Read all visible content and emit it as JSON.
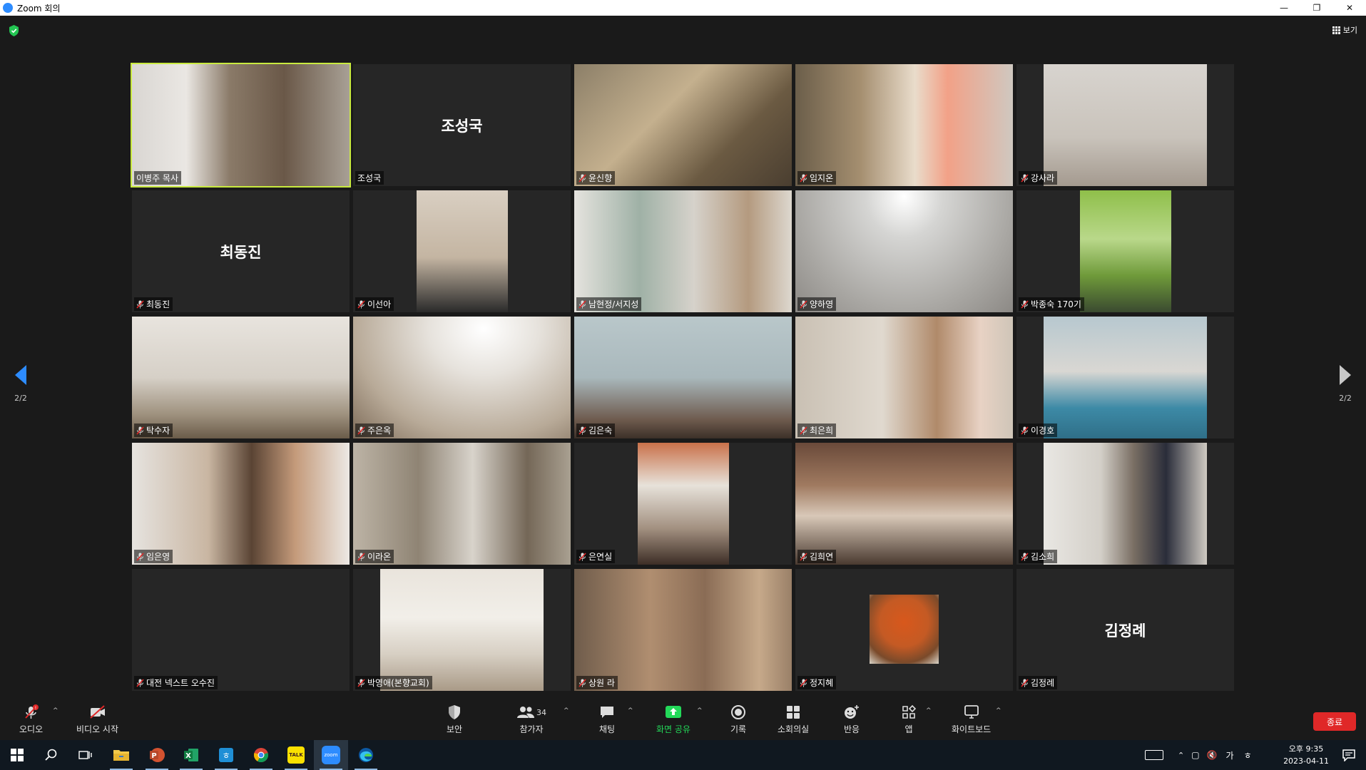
{
  "window": {
    "title": "Zoom 회의"
  },
  "top": {
    "view_label": "보기"
  },
  "nav": {
    "prev_page": "2/2",
    "next_page": "2/2"
  },
  "participants": [
    {
      "name": "이병주 목사",
      "video": true
    },
    {
      "name": "조성국",
      "video": false
    },
    {
      "name": "윤신향",
      "video": true
    },
    {
      "name": "임지온",
      "video": true
    },
    {
      "name": "강사라",
      "video": true
    },
    {
      "name": "최동진",
      "video": false
    },
    {
      "name": "이선아",
      "video": true
    },
    {
      "name": "남현정/서지성",
      "video": true
    },
    {
      "name": "양하영",
      "video": true
    },
    {
      "name": "박종숙 170기",
      "video": true
    },
    {
      "name": "탁수자",
      "video": true
    },
    {
      "name": "주은옥",
      "video": true
    },
    {
      "name": "김은숙",
      "video": true
    },
    {
      "name": "최은희",
      "video": true
    },
    {
      "name": "이경호",
      "video": true
    },
    {
      "name": "임은영",
      "video": true
    },
    {
      "name": "이라온",
      "video": true
    },
    {
      "name": "은연실",
      "video": true
    },
    {
      "name": "김희연",
      "video": true
    },
    {
      "name": "김소희",
      "video": true
    },
    {
      "name": "대전 넥스트 오수진",
      "video": false
    },
    {
      "name": "박영애(본향교회)",
      "video": true
    },
    {
      "name": "상원 라",
      "video": true
    },
    {
      "name": "정지혜",
      "video": false
    },
    {
      "name": "김정례",
      "video": false
    }
  ],
  "big_names": {
    "t1": "조성국",
    "t5": "최동진",
    "t24": "김정례"
  },
  "toolbar": {
    "audio": "오디오",
    "video": "비디오 시작",
    "security": "보안",
    "participants": "참가자",
    "participants_count": "34",
    "chat": "채팅",
    "share": "화면 공유",
    "record": "기록",
    "breakout": "소회의실",
    "reactions": "반응",
    "apps": "앱",
    "whiteboard": "화이트보드",
    "end": "종료"
  },
  "taskbar": {
    "ime_1": "가",
    "ime_2": "ㅎ",
    "time": "오후 9:35",
    "date": "2023-04-11",
    "kakao_label": "TALK",
    "zoom_label": "zoom"
  },
  "colors": {
    "accent": "#2d8cff",
    "active_speaker": "#c9ea3f",
    "end": "#e02828",
    "share": "#23d959",
    "mute": "#e02828"
  }
}
